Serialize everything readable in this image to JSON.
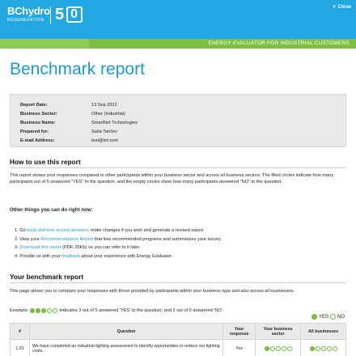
{
  "header": {
    "brand": "BChydro",
    "brand_sub": "REGENERATION",
    "anniversary_number": "5",
    "anniversary_box": "0",
    "close_label": "Close",
    "close_icon": "✕",
    "banner": "ENERGY EVALUATOR FOR INDUSTRIAL CUSTOMERS"
  },
  "page_title": "Benchmark report",
  "info": [
    {
      "label": "Report Date:",
      "value": "13 Sep 2012"
    },
    {
      "label": "Business Sector:",
      "value": "Other (Industrial)"
    },
    {
      "label": "Business Name:",
      "value": "SmartNet Trchnologies"
    },
    {
      "label": "Prepared for:",
      "value": "Saša Tančev"
    },
    {
      "label": "E-mail Address:",
      "value": "test@tet.com"
    }
  ],
  "how_to": {
    "heading": "How to use this report",
    "body": "This report shows your responses compared to other participants within your business sector and across all business sectors. The filled circles indicate how many participants out of 5 answered \"YES\" to the question, and the empty circles show how many participants answered \"NO\" to the question."
  },
  "other_things": {
    "heading": "Other things you can do right now:",
    "steps": [
      {
        "num": "1.",
        "pre": "Go ",
        "link": "back and look at your answers",
        "post": ", make changes if you wish and generate a revised report."
      },
      {
        "num": "2.",
        "pre": "View your ",
        "link": "Recommendations Report",
        "post": " that lists recommended programs and summarizes your survey."
      },
      {
        "num": "3.",
        "pre": "",
        "link": "Download this report",
        "post": " (PDF, 25Kb) so you can refer to it later."
      },
      {
        "num": "4.",
        "pre": "Provide us with your ",
        "link": "feedback",
        "post": " about your experience with Energy Evaluator."
      }
    ]
  },
  "benchmark": {
    "heading": "Your benchmark report",
    "body": "This page allows you to compare your responses with those provided by participants within your business type and also across all businesses.",
    "example_prefix": "Example:",
    "example_text": "Indicates 3 out of 5 answered 'YES' to the question; and 2 out of 5 answered 'NO'.",
    "example_yes": 3,
    "example_total": 5,
    "legend_yes": "YES",
    "legend_no": "NO"
  },
  "table": {
    "headers": [
      "#",
      "Question",
      "Your response",
      "Your business sector",
      "All businesses"
    ],
    "rows": [
      {
        "num": "1.01",
        "question": "We have completed an industrial lighting assessment to identify opportunities to reduce our lighting costs.",
        "response": "Yes",
        "sector_yes": 1,
        "all_yes": 1,
        "total": 5
      }
    ]
  },
  "colors": {
    "accent_blue": "#23a7e0",
    "accent_green": "#7cc142",
    "title_blue": "#1c9ad6"
  }
}
